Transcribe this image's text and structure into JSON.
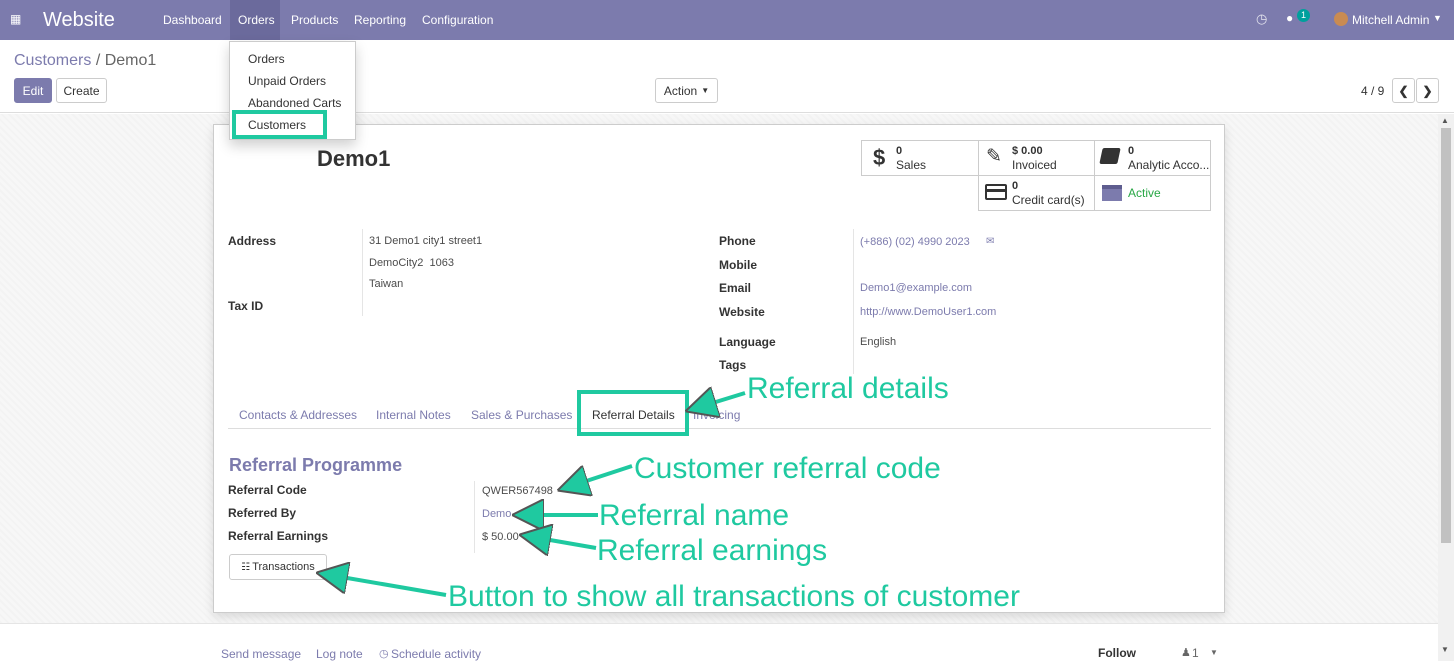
{
  "topbar": {
    "app": "Website",
    "menus": [
      "Dashboard",
      "Orders",
      "Products",
      "Reporting",
      "Configuration"
    ],
    "chat_count": "1",
    "user": "Mitchell Admin"
  },
  "breadcrumb": {
    "parent": "Customers",
    "sep": "/",
    "current": "Demo1"
  },
  "buttons": {
    "edit": "Edit",
    "create": "Create",
    "action": "Action"
  },
  "pager": "4 / 9",
  "dropdown": [
    "Orders",
    "Unpaid Orders",
    "Abandoned Carts",
    "Customers"
  ],
  "title": "Demo1",
  "stats": [
    {
      "num": "0",
      "label": "Sales"
    },
    {
      "num": "$ 0.00",
      "label": "Invoiced"
    },
    {
      "num": "0",
      "label": "Analytic Acco..."
    },
    {
      "num": "0",
      "label": "Credit card(s)"
    },
    {
      "label": "Active"
    }
  ],
  "address": {
    "label": "Address",
    "lines": [
      "31 Demo1 city1 street1",
      "DemoCity2  1063",
      "Taiwan"
    ],
    "taxid": "Tax ID"
  },
  "contact": {
    "phone_label": "Phone",
    "phone": "(+886) (02) 4990 2023",
    "mobile_label": "Mobile",
    "email_label": "Email",
    "email": "Demo1@example.com",
    "website_label": "Website",
    "website": "http://www.DemoUser1.com",
    "language_label": "Language",
    "language": "English",
    "tags_label": "Tags"
  },
  "tabs": [
    "Contacts & Addresses",
    "Internal Notes",
    "Sales & Purchases",
    "Referral Details",
    "Invoicing"
  ],
  "referral": {
    "heading": "Referral Programme",
    "code_label": "Referral Code",
    "code": "QWER567498",
    "by_label": "Referred By",
    "by": "Demo",
    "earn_label": "Referral Earnings",
    "earn": "$ 50.00",
    "transactions": "Transactions"
  },
  "annotations": {
    "details": "Referral details",
    "code": "Customer referral code",
    "name": "Referral name",
    "earnings": "Referral earnings",
    "button": "Button to show all transactions of customer"
  },
  "chatter": {
    "send": "Send message",
    "log": "Log note",
    "schedule": "Schedule activity",
    "follow": "Follow",
    "followers": "1"
  },
  "colors": {
    "brand": "#7c7bad",
    "annotation": "#1fc9a0",
    "active": "#28a745"
  }
}
